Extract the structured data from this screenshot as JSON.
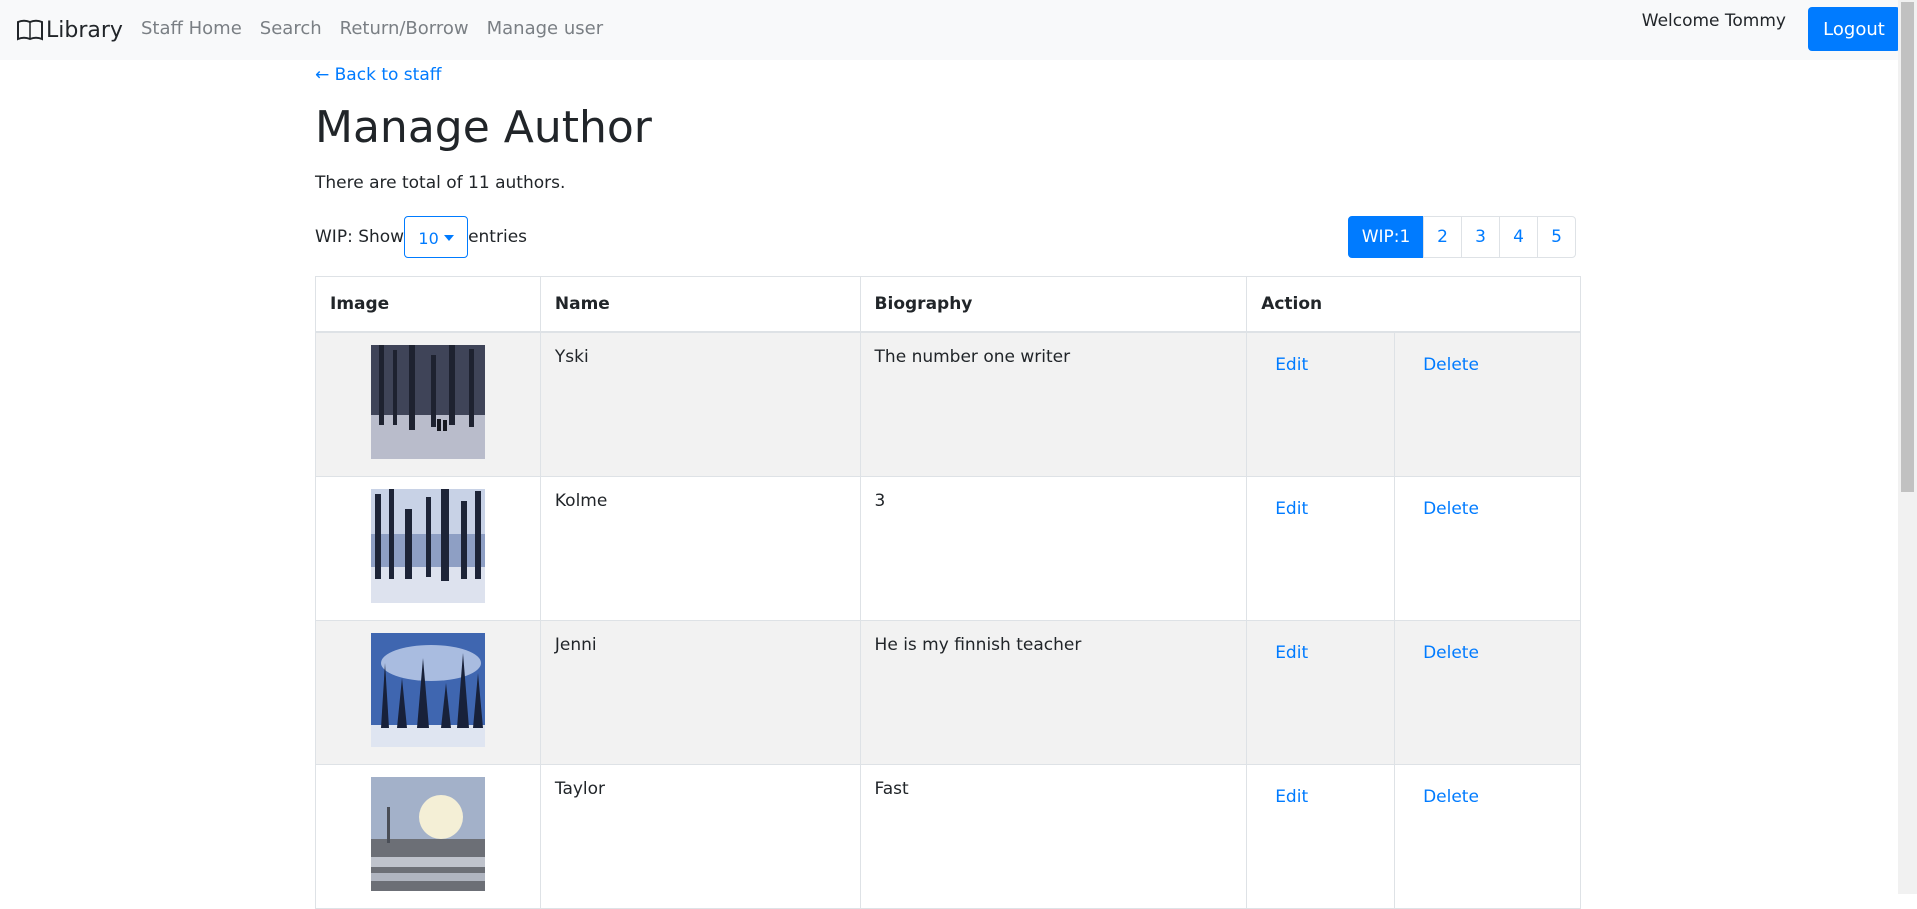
{
  "navbar": {
    "brand": "Library",
    "brand_icon": "book-icon",
    "links": [
      "Staff Home",
      "Search",
      "Return/Borrow",
      "Manage user"
    ],
    "welcome": "Welcome Tommy",
    "logout_label": "Logout"
  },
  "main": {
    "back_link": "← Back to staff",
    "title": "Manage Author",
    "total_text": "There are total of 11 authors.",
    "show_prefix": "WIP: Show",
    "show_value": "10",
    "show_suffix": "entries",
    "pagination": [
      "WIP:1",
      "2",
      "3",
      "4",
      "5"
    ],
    "active_page": "WIP:1"
  },
  "table": {
    "headers": [
      "Image",
      "Name",
      "Biography",
      "Action"
    ],
    "rows": [
      {
        "name": "Yski",
        "biography": "The number one writer",
        "edit": "Edit",
        "delete": "Delete",
        "image": "snowy-forest-dark"
      },
      {
        "name": "Kolme",
        "biography": "3",
        "edit": "Edit",
        "delete": "Delete",
        "image": "snowy-forest-sky"
      },
      {
        "name": "Jenni",
        "biography": "He is my finnish teacher",
        "edit": "Edit",
        "delete": "Delete",
        "image": "snowy-forest-blue-sky"
      },
      {
        "name": "Taylor",
        "biography": "Fast",
        "edit": "Edit",
        "delete": "Delete",
        "image": "winter-sunset"
      }
    ]
  },
  "colors": {
    "primary": "#007bff",
    "navbar_bg": "#f8f9fa",
    "stripe": "#f2f2f2"
  }
}
